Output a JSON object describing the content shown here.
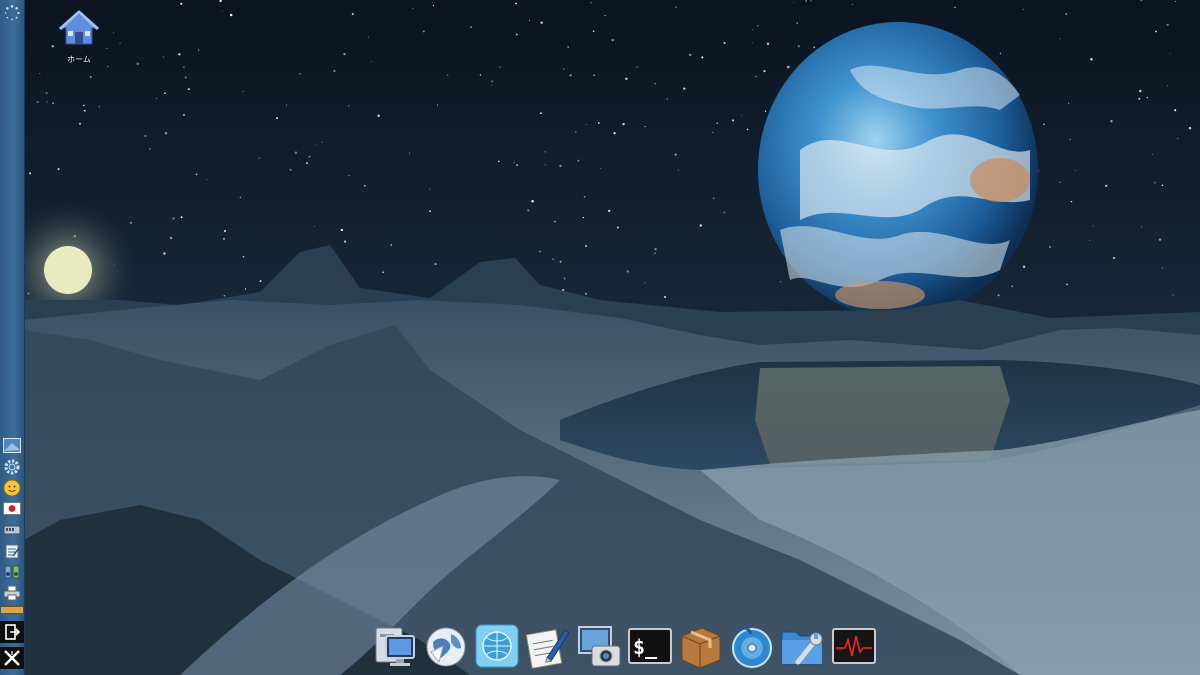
{
  "desktop": {
    "icons": [
      {
        "label": "ホーム",
        "icon": "home-folder-icon"
      }
    ]
  },
  "side_panel": {
    "top_icon": "loading-spinner-icon",
    "tray_icons": [
      "screen-preview-icon",
      "gear-icon",
      "user-avatar-icon",
      "japan-flag-icon",
      "network-icon",
      "clipboard-icon",
      "volume-icon",
      "printer-icon"
    ],
    "bottom_icons": [
      "logout-icon",
      "x-logo-icon"
    ]
  },
  "dock": {
    "items": [
      {
        "name": "file-manager",
        "icon": "computer-icon"
      },
      {
        "name": "browser",
        "icon": "globe-icon"
      },
      {
        "name": "network-browser",
        "icon": "globe-blue-icon"
      },
      {
        "name": "text-editor",
        "icon": "notepad-pencil-icon"
      },
      {
        "name": "screenshot",
        "icon": "camera-screen-icon"
      },
      {
        "name": "terminal",
        "icon": "terminal-icon",
        "text": "$_"
      },
      {
        "name": "package-manager",
        "icon": "package-box-icon"
      },
      {
        "name": "disc-burner",
        "icon": "disc-icon"
      },
      {
        "name": "settings-tool",
        "icon": "folder-wrench-icon"
      },
      {
        "name": "system-monitor",
        "icon": "heartbeat-monitor-icon"
      }
    ]
  },
  "colors": {
    "panel": "#3b6d99",
    "sky": "#0b1622",
    "planet": "#2f7fc0"
  }
}
